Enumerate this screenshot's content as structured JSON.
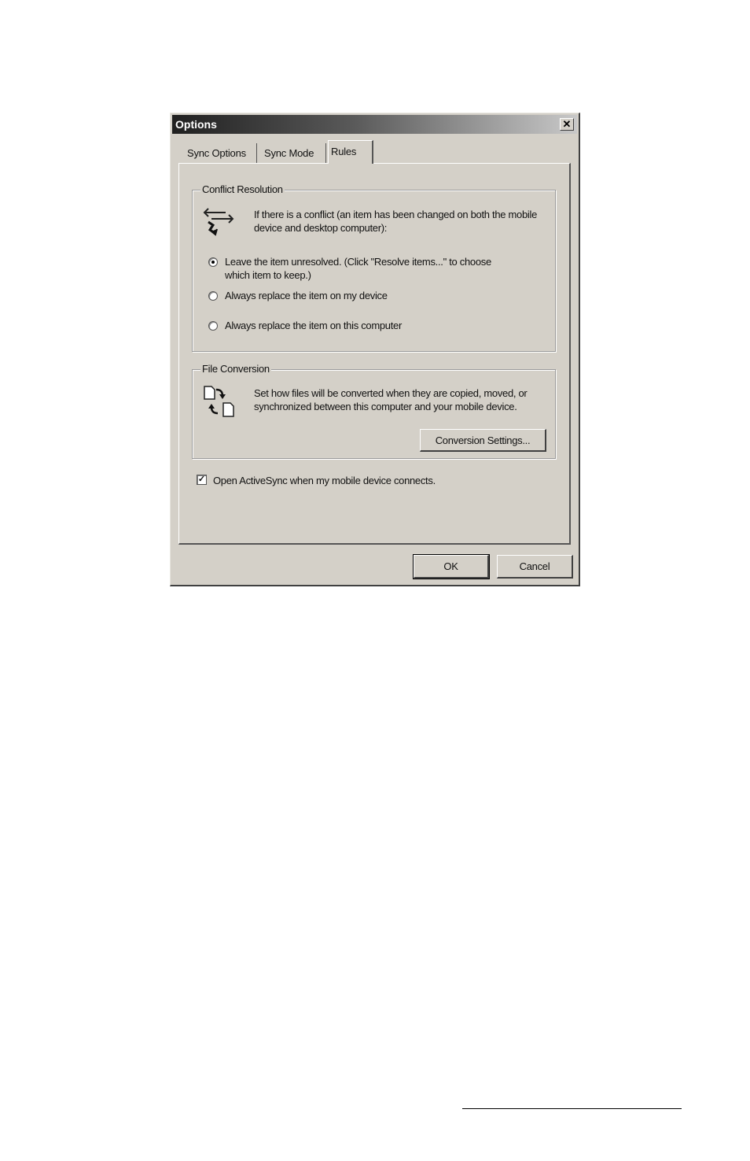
{
  "dialog": {
    "title": "Options",
    "close_glyph": "✕"
  },
  "tabs": [
    {
      "label": "Sync Options"
    },
    {
      "label": "Sync Mode"
    },
    {
      "label": "Rules"
    }
  ],
  "conflict_resolution": {
    "legend": "Conflict Resolution",
    "icon": "sync-arrows-icon",
    "description": "If there is a conflict (an item has been changed on both the mobile device and desktop computer):",
    "options": [
      {
        "label": "Leave the item unresolved. (Click \"Resolve items...\" to choose which item to keep.)",
        "selected": true
      },
      {
        "label": "Always replace the item on my device",
        "selected": false
      },
      {
        "label": "Always replace the item on this computer",
        "selected": false
      }
    ]
  },
  "file_conversion": {
    "legend": "File Conversion",
    "icon": "file-convert-icon",
    "description": "Set how files will be converted when they are copied, moved, or synchronized between this computer and your mobile device.",
    "button_label": "Conversion Settings..."
  },
  "open_activesync": {
    "label": "Open ActiveSync when my mobile device connects.",
    "checked": true,
    "check_glyph": "✓"
  },
  "buttons": {
    "ok": "OK",
    "cancel": "Cancel"
  }
}
